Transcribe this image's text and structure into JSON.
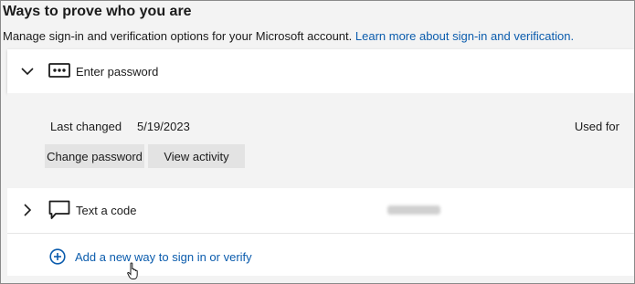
{
  "header": {
    "title": "Ways to prove who you are",
    "subtitle": "Manage sign-in and verification options for your Microsoft account.",
    "learn_more_link": "Learn more about sign-in and verification."
  },
  "methods": [
    {
      "label": "Enter password",
      "icon": "password-dots-icon",
      "expanded": true,
      "last_changed_label": "Last changed",
      "last_changed_value": "5/19/2023",
      "used_for_label": "Used for",
      "actions": [
        "Change password",
        "View activity"
      ]
    },
    {
      "label": "Text a code",
      "icon": "chat-message-icon",
      "expanded": false
    }
  ],
  "add_method": {
    "label": "Add a new way to sign in or verify",
    "icon": "plus-circle-icon"
  },
  "colors": {
    "link": "#0b5cad",
    "background": "#f3f3f3",
    "card": "#ffffff",
    "button": "#e3e3e3"
  }
}
